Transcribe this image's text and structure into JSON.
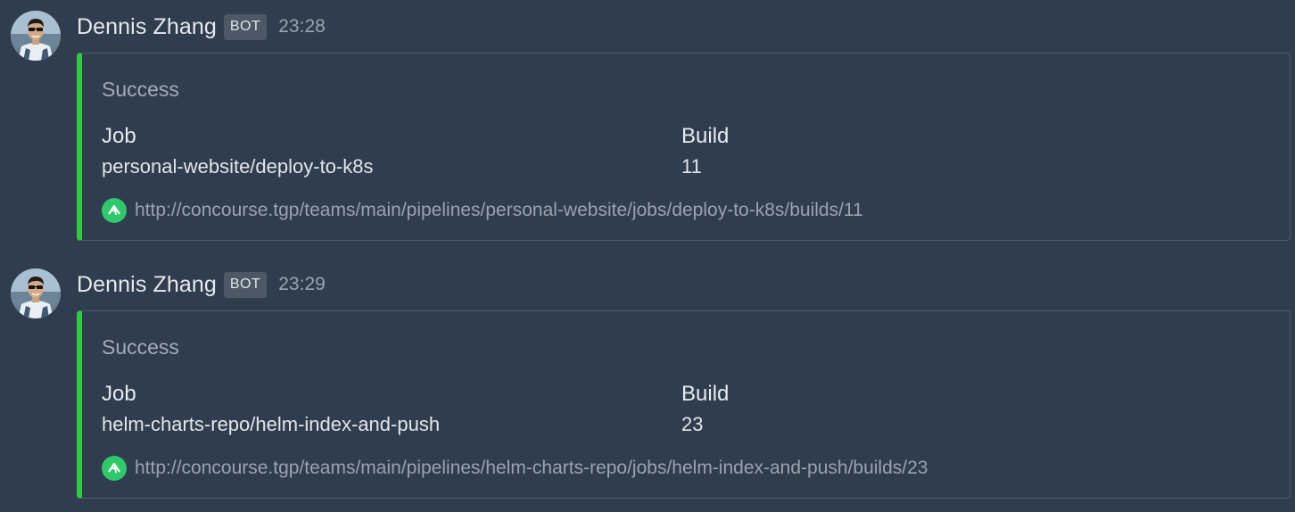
{
  "messages": [
    {
      "author": "Dennis Zhang",
      "badge": "BOT",
      "time": "23:28",
      "embed": {
        "accent_color": "#2ecc40",
        "title": "Success",
        "fields": [
          {
            "name": "Job",
            "value": "personal-website/deploy-to-k8s"
          },
          {
            "name": "Build",
            "value": "11"
          }
        ],
        "footer_icon": "concourse-icon",
        "footer_link": "http://concourse.tgp/teams/main/pipelines/personal-website/jobs/deploy-to-k8s/builds/11"
      }
    },
    {
      "author": "Dennis Zhang",
      "badge": "BOT",
      "time": "23:29",
      "embed": {
        "accent_color": "#2ecc40",
        "title": "Success",
        "fields": [
          {
            "name": "Job",
            "value": "helm-charts-repo/helm-index-and-push"
          },
          {
            "name": "Build",
            "value": "23"
          }
        ],
        "footer_icon": "concourse-icon",
        "footer_link": "http://concourse.tgp/teams/main/pipelines/helm-charts-repo/jobs/helm-index-and-push/builds/23"
      }
    }
  ]
}
